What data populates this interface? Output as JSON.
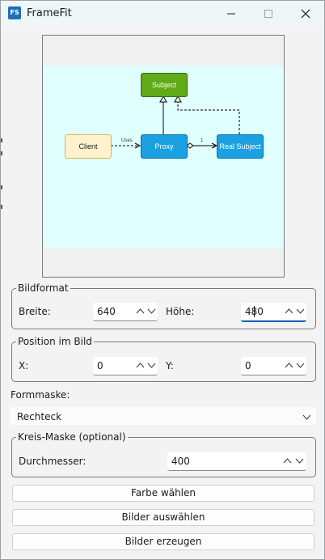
{
  "window": {
    "title": "FrameFit",
    "icon_text": "FS"
  },
  "preview": {
    "diagram": {
      "subject": "Subject",
      "client": "Client",
      "proxy": "Proxy",
      "real_subject": "Real Subject",
      "uses_label": "Uses",
      "multiplicity": "1"
    }
  },
  "bildformat": {
    "legend": "Bildformat",
    "breite_label": "Breite:",
    "breite_value": "640",
    "hoehe_label": "Höhe:",
    "hoehe_value": "480"
  },
  "position": {
    "legend": "Position im Bild",
    "x_label": "X:",
    "x_value": "0",
    "y_label": "Y:",
    "y_value": "0"
  },
  "formmaske": {
    "label": "Formmaske:",
    "selected": "Rechteck"
  },
  "kreis": {
    "legend": "Kreis-Maske (optional)",
    "durchmesser_label": "Durchmesser:",
    "durchmesser_value": "400"
  },
  "buttons": {
    "farbe": "Farbe wählen",
    "auswaehlen": "Bilder auswählen",
    "erzeugen": "Bilder erzeugen"
  }
}
